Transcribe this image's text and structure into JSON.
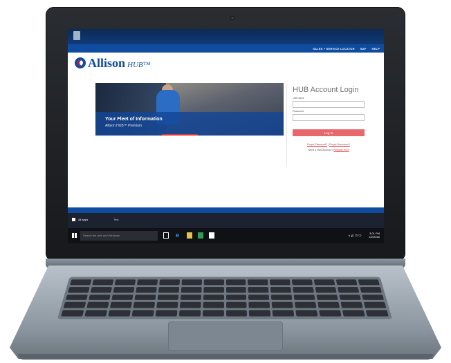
{
  "site": {
    "top_links": [
      "SALES + SERVICE LOCATOR",
      "SAP",
      "HELP"
    ],
    "logo": {
      "brand": "Allison",
      "product": "HUB™"
    },
    "hero": {
      "title": "Your Fleet of Information",
      "subtitle": "Allison HUB™ Premium"
    },
    "login": {
      "title": "HUB Account Login",
      "username_label": "Username",
      "password_label": "Password",
      "button_label": "Log In",
      "forgot_password": "Forgot Password?",
      "separator": " | ",
      "forgot_username": "Forgot Username?",
      "need_account": "Need a HUB Account?",
      "register": "Register Here"
    }
  },
  "os": {
    "start_menu": {
      "all_apps": "All apps",
      "section": "Test"
    },
    "search_placeholder": "Search the web and Windows",
    "tray_time": "3:01 PM",
    "tray_date": "2/2/2016",
    "tray_icons": "∧ 🔊 ⊡ 🗨"
  },
  "colors": {
    "brand_blue": "#0f4ca0",
    "accent_red": "#d9373c",
    "button_red": "#e8676a"
  }
}
